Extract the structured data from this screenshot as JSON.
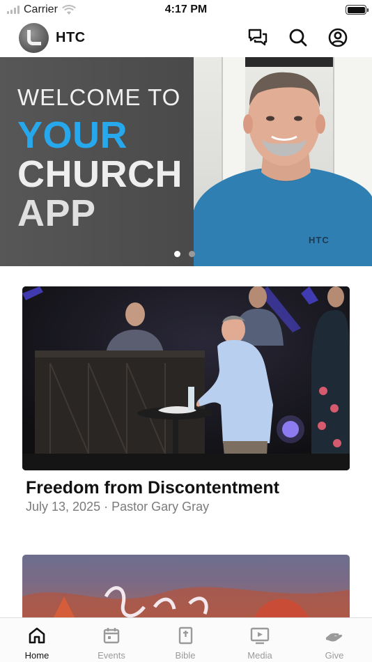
{
  "status_bar": {
    "carrier": "Carrier",
    "time": "4:17 PM"
  },
  "header": {
    "app_name": "HTC",
    "icons": [
      "chat-bubbles-icon",
      "search-icon",
      "account-icon"
    ]
  },
  "hero": {
    "line1": "WELCOME TO",
    "line2": "YOUR",
    "line3": "CHURCH",
    "line4": "APP",
    "accent_color": "#27a8ec",
    "shirt_text": "HTC",
    "slide_count": 2,
    "active_slide": 1
  },
  "sermon": {
    "title": "Freedom from Discontentment",
    "meta": "July 13, 2025 · Pastor Gary Gray"
  },
  "tabs": [
    {
      "label": "Home",
      "icon": "home-icon",
      "active": true
    },
    {
      "label": "Events",
      "icon": "calendar-icon",
      "active": false
    },
    {
      "label": "Bible",
      "icon": "bible-icon",
      "active": false
    },
    {
      "label": "Media",
      "icon": "media-icon",
      "active": false
    },
    {
      "label": "Give",
      "icon": "give-icon",
      "active": false
    }
  ],
  "colors": {
    "active_tab": "#111111",
    "inactive_tab": "#9a9a9a",
    "meta_text": "#7b7b7b"
  }
}
